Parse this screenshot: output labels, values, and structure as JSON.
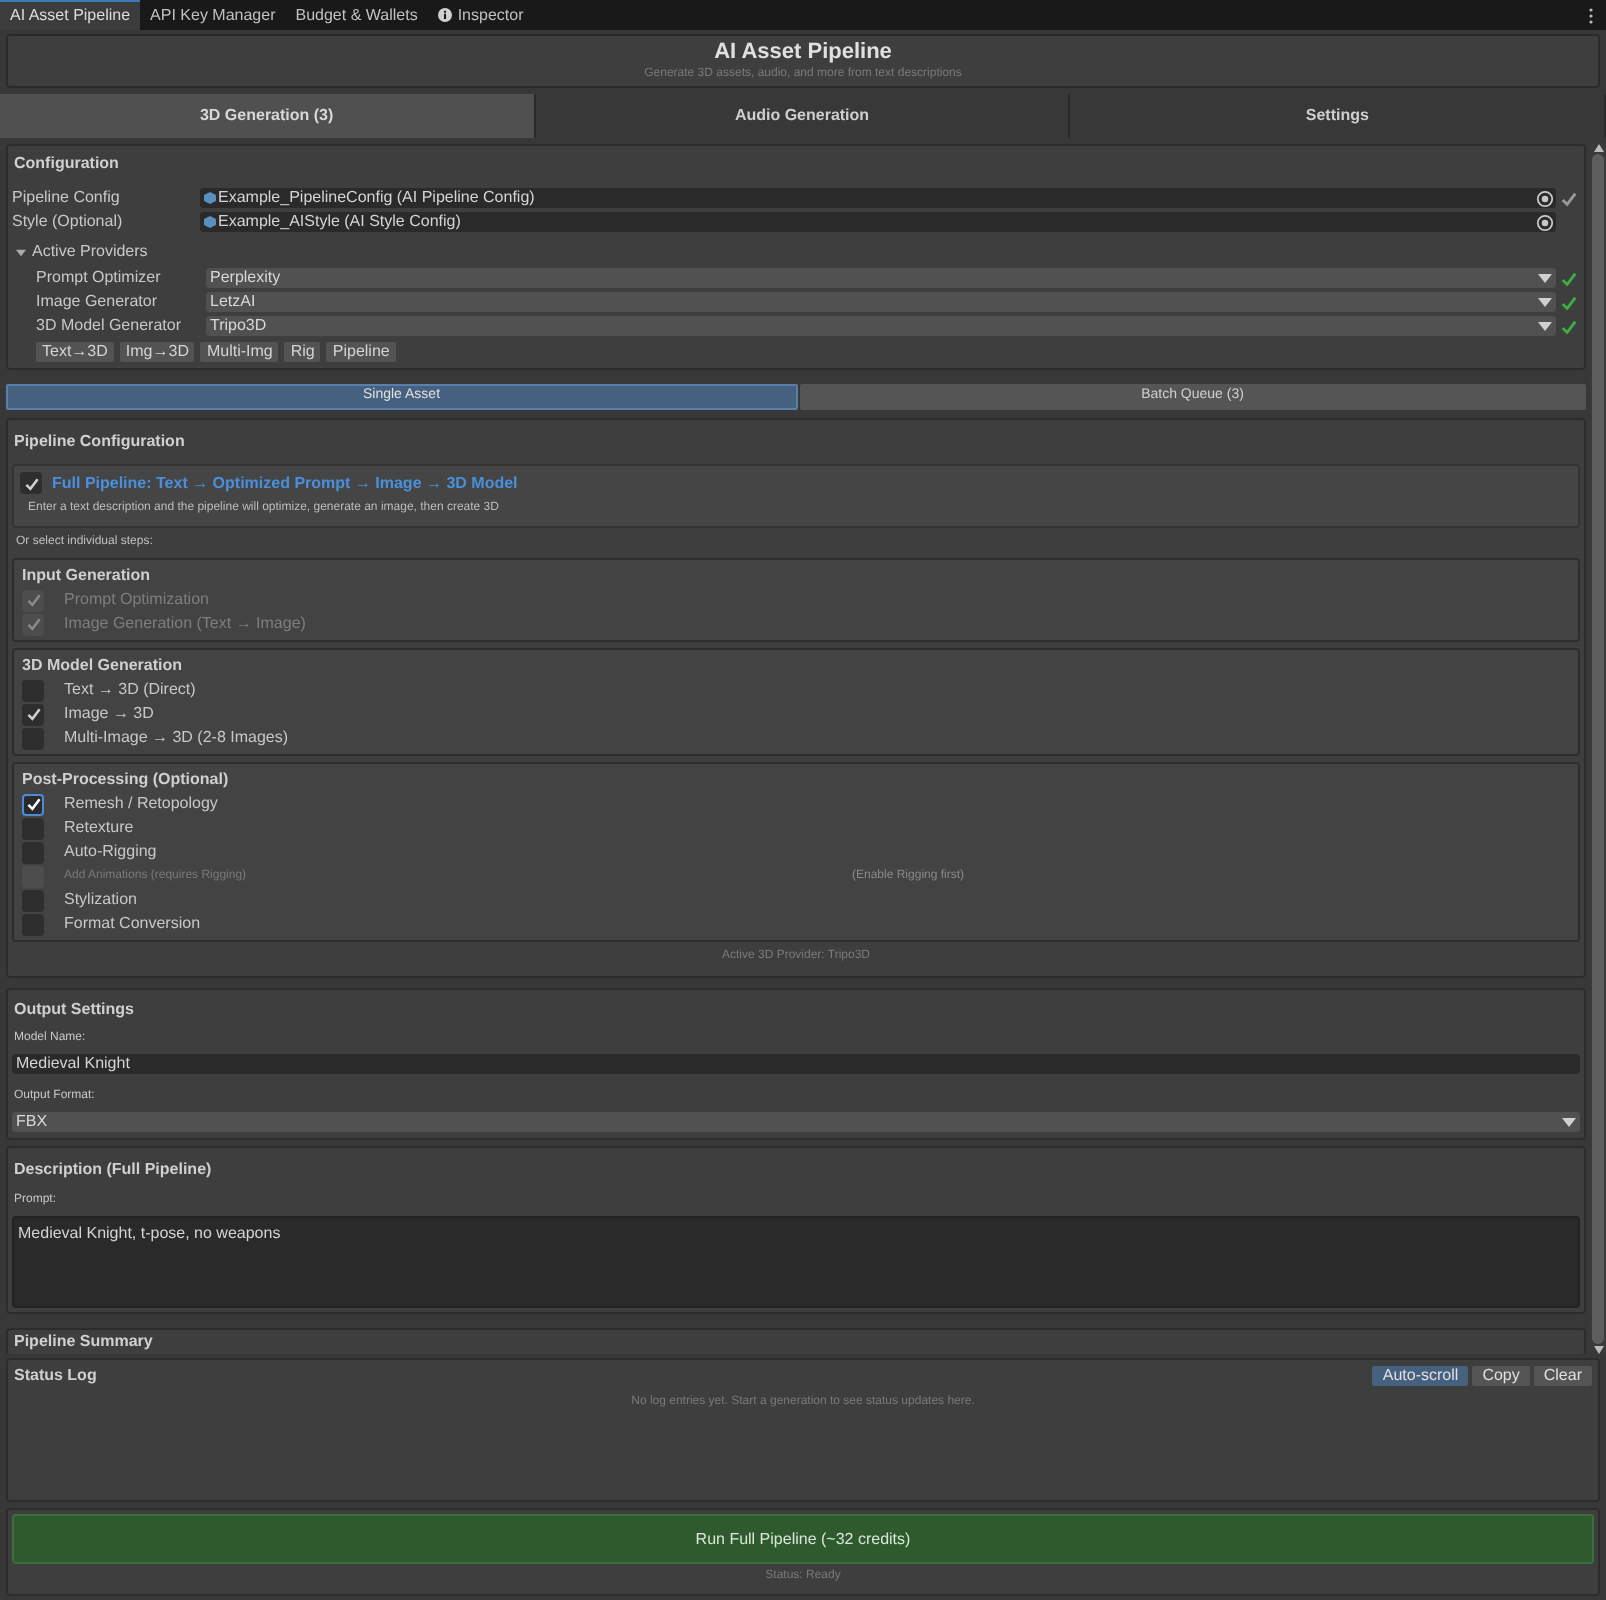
{
  "window_tabs": [
    {
      "label": "AI Asset Pipeline",
      "selected": true,
      "icon": false
    },
    {
      "label": "API Key Manager",
      "selected": false,
      "icon": false
    },
    {
      "label": "Budget & Wallets",
      "selected": false,
      "icon": false
    },
    {
      "label": "Inspector",
      "selected": false,
      "icon": true
    }
  ],
  "header": {
    "title": "AI Asset Pipeline",
    "subtitle": "Generate 3D assets, audio, and more from text descriptions"
  },
  "main_tabs": [
    {
      "label": "3D Generation (3)",
      "selected": true
    },
    {
      "label": "Audio Generation",
      "selected": false
    },
    {
      "label": "Settings",
      "selected": false
    }
  ],
  "configuration": {
    "title": "Configuration",
    "fields": [
      {
        "label": "Pipeline Config",
        "value": "Example_PipelineConfig (AI Pipeline Config)",
        "valid": true
      },
      {
        "label": "Style (Optional)",
        "value": "Example_AIStyle (AI Style Config)",
        "valid": false
      }
    ],
    "providers": {
      "label": "Active Providers",
      "expanded": true,
      "items": [
        {
          "label": "Prompt Optimizer",
          "value": "Perplexity",
          "valid": true
        },
        {
          "label": "Image Generator",
          "value": "LetzAI",
          "valid": true
        },
        {
          "label": "3D Model Generator",
          "value": "Tripo3D",
          "valid": true
        }
      ],
      "capabilities": [
        "Text→3D",
        "Img→3D",
        "Multi-Img",
        "Rig",
        "Pipeline"
      ]
    }
  },
  "mode_tabs": [
    {
      "label": "Single Asset",
      "selected": true
    },
    {
      "label": "Batch Queue (3)",
      "selected": false
    }
  ],
  "pipeline_configuration": {
    "title": "Pipeline Configuration",
    "full_pipeline": {
      "label": "Full Pipeline: Text → Optimized Prompt → Image → 3D Model",
      "checked": true,
      "description": "Enter a text description and the pipeline will optimize, generate an image, then create 3D"
    },
    "steps_hint": "Or select individual steps:",
    "groups": [
      {
        "title": "Input Generation",
        "items": [
          {
            "label": "Prompt Optimization",
            "checked": true,
            "disabled": true
          },
          {
            "label": "Image Generation (Text → Image)",
            "checked": true,
            "disabled": true
          }
        ]
      },
      {
        "title": "3D Model Generation",
        "items": [
          {
            "label": "Text → 3D (Direct)",
            "checked": false,
            "disabled": false
          },
          {
            "label": "Image → 3D",
            "checked": true,
            "disabled": false
          },
          {
            "label": "Multi-Image → 3D (2-8 Images)",
            "checked": false,
            "disabled": false
          }
        ]
      },
      {
        "title": "Post-Processing (Optional)",
        "items": [
          {
            "label": "Remesh / Retopology",
            "checked": true,
            "disabled": false
          },
          {
            "label": "Retexture",
            "checked": false,
            "disabled": false
          },
          {
            "label": "Auto-Rigging",
            "checked": false,
            "disabled": false
          },
          {
            "label": "Add Animations (requires Rigging)",
            "checked": false,
            "disabled": true,
            "note": "(Enable Rigging first)"
          },
          {
            "label": "Stylization",
            "checked": false,
            "disabled": false
          },
          {
            "label": "Format Conversion",
            "checked": false,
            "disabled": false
          }
        ]
      }
    ],
    "active_provider": "Active 3D Provider: Tripo3D"
  },
  "output_settings": {
    "title": "Output Settings",
    "model_name_label": "Model Name:",
    "model_name": "Medieval Knight",
    "format_label": "Output Format:",
    "format": "FBX"
  },
  "description": {
    "title": "Description (Full Pipeline)",
    "prompt_label": "Prompt:",
    "prompt": "Medieval Knight, t-pose, no weapons"
  },
  "pipeline_summary": {
    "title": "Pipeline Summary"
  },
  "status_log": {
    "title": "Status Log",
    "buttons": [
      {
        "label": "Auto-scroll",
        "selected": true
      },
      {
        "label": "Copy",
        "selected": false
      },
      {
        "label": "Clear",
        "selected": false
      }
    ],
    "empty_text": "No log entries yet. Start a generation to see status updates here."
  },
  "run_button": "Run Full Pipeline (~32 credits)",
  "status": "Status: Ready"
}
